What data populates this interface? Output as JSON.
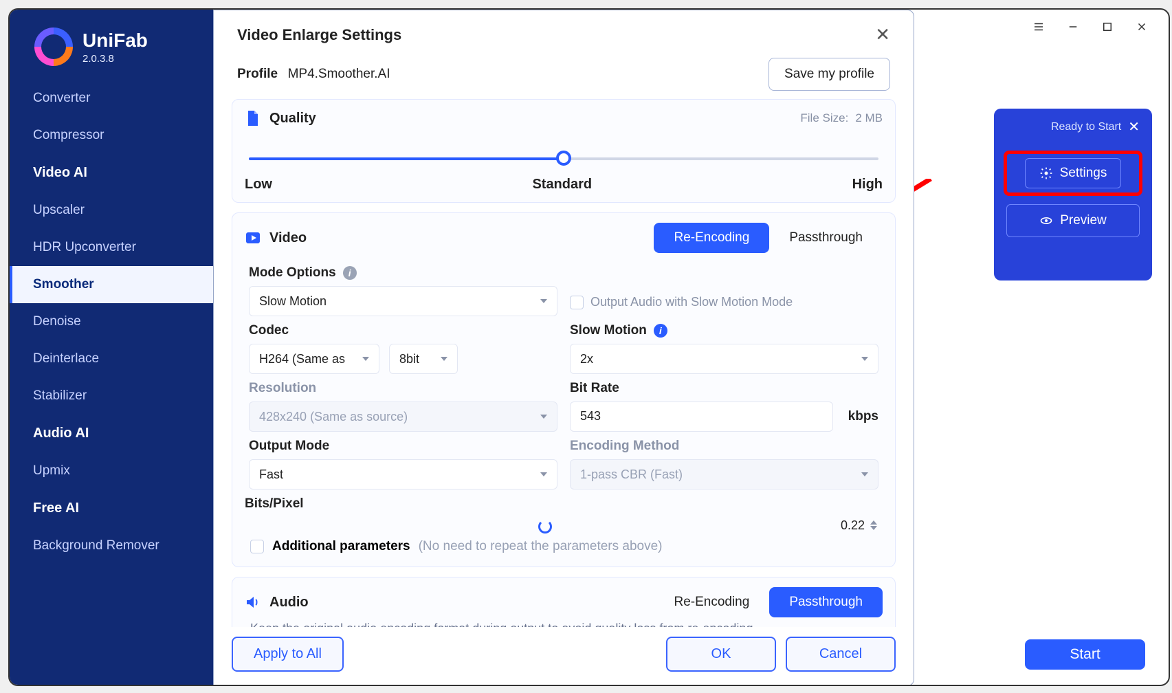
{
  "app": {
    "name": "UniFab",
    "version": "2.0.3.8"
  },
  "titlebar": {
    "menu_icon": "menu-icon",
    "minimize_icon": "minimize-icon",
    "maximize_icon": "maximize-icon",
    "close_icon": "close-icon"
  },
  "sidebar": {
    "items": [
      {
        "label": "Converter",
        "kind": "item"
      },
      {
        "label": "Compressor",
        "kind": "item"
      },
      {
        "label": "Video AI",
        "kind": "section"
      },
      {
        "label": "Upscaler",
        "kind": "item"
      },
      {
        "label": "HDR Upconverter",
        "kind": "item"
      },
      {
        "label": "Smoother",
        "kind": "item",
        "active": true
      },
      {
        "label": "Denoise",
        "kind": "item"
      },
      {
        "label": "Deinterlace",
        "kind": "item"
      },
      {
        "label": "Stabilizer",
        "kind": "item"
      },
      {
        "label": "Audio AI",
        "kind": "section"
      },
      {
        "label": "Upmix",
        "kind": "item"
      },
      {
        "label": "Free AI",
        "kind": "section"
      },
      {
        "label": "Background Remover",
        "kind": "item"
      }
    ]
  },
  "right_panel": {
    "status": "Ready to Start",
    "settings_btn": "Settings",
    "preview_btn": "Preview"
  },
  "start_btn": "Start",
  "dialog": {
    "title": "Video Enlarge Settings",
    "profile_label": "Profile",
    "profile_value": "MP4.Smoother.AI",
    "save_profile": "Save my profile",
    "quality": {
      "heading": "Quality",
      "file_size_label": "File Size:",
      "file_size_value": "2 MB",
      "low": "Low",
      "standard": "Standard",
      "high": "High",
      "value_pct": 50
    },
    "video": {
      "heading": "Video",
      "tab_re": "Re-Encoding",
      "tab_pass": "Passthrough",
      "active_tab": "re",
      "mode_options_label": "Mode Options",
      "mode_value": "Slow Motion",
      "output_audio_label": "Output Audio with Slow Motion Mode",
      "codec_label": "Codec",
      "codec_value": "H264 (Same as",
      "bit_depth_value": "8bit",
      "slow_motion_label": "Slow Motion",
      "slow_motion_value": "2x",
      "resolution_label": "Resolution",
      "resolution_value": "428x240 (Same as source)",
      "bit_rate_label": "Bit Rate",
      "bit_rate_value": "543",
      "bit_rate_unit": "kbps",
      "output_mode_label": "Output Mode",
      "output_mode_value": "Fast",
      "encoding_method_label": "Encoding Method",
      "encoding_method_value": "1-pass CBR (Fast)",
      "bits_pixel_label": "Bits/Pixel",
      "bits_pixel_value": "0.22",
      "additional_params_label": "Additional parameters",
      "additional_params_hint": "(No need to repeat the parameters above)"
    },
    "audio": {
      "heading": "Audio",
      "tab_re": "Re-Encoding",
      "tab_pass": "Passthrough",
      "active_tab": "pass",
      "clipped_text": "Keep the original audio encoding format during output to avoid quality loss from re-encoding"
    },
    "footer": {
      "apply_all": "Apply to All",
      "ok": "OK",
      "cancel": "Cancel"
    }
  }
}
